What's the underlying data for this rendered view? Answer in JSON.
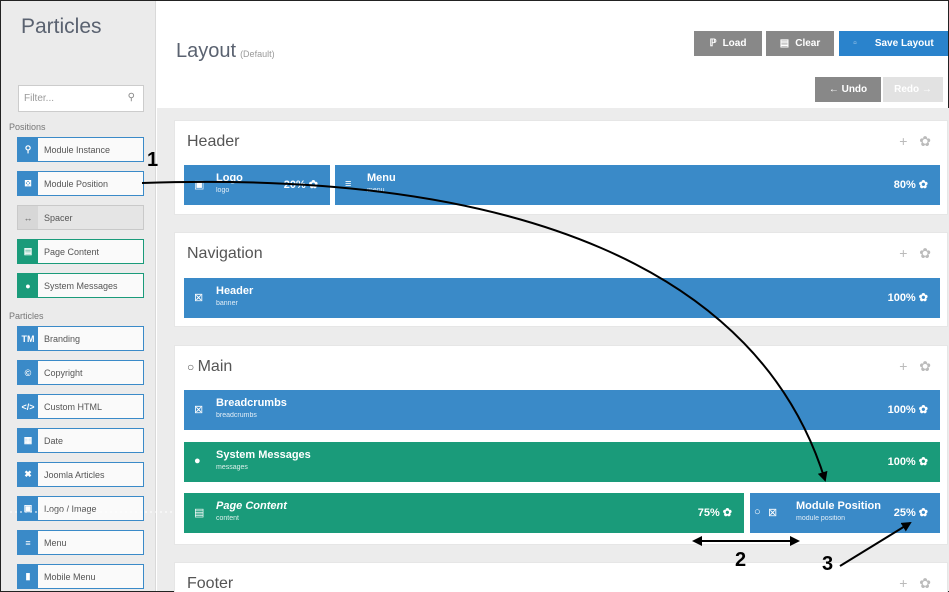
{
  "sidebar": {
    "title": "Particles",
    "filter_placeholder": "Filter...",
    "positions_label": "Positions",
    "particles_label": "Particles",
    "positions": [
      {
        "label": "Module Instance",
        "icon": "puzzle-icon",
        "glyph": "⚲"
      },
      {
        "label": "Module Position",
        "icon": "module-position-icon",
        "glyph": "⊠"
      },
      {
        "label": "Spacer",
        "icon": "spacer-icon",
        "glyph": "↔"
      },
      {
        "label": "Page Content",
        "icon": "file-icon",
        "glyph": "▤"
      },
      {
        "label": "System Messages",
        "icon": "info-icon",
        "glyph": "●"
      }
    ],
    "particles": [
      {
        "label": "Branding",
        "icon": "trademark-icon",
        "glyph": "TM"
      },
      {
        "label": "Copyright",
        "icon": "copyright-icon",
        "glyph": "©"
      },
      {
        "label": "Custom HTML",
        "icon": "code-icon",
        "glyph": "</>"
      },
      {
        "label": "Date",
        "icon": "calendar-icon",
        "glyph": "▦"
      },
      {
        "label": "Joomla Articles",
        "icon": "joomla-icon",
        "glyph": "✖"
      },
      {
        "label": "Logo / Image",
        "icon": "image-icon",
        "glyph": "▣"
      },
      {
        "label": "Menu",
        "icon": "menu-icon",
        "glyph": "≡"
      },
      {
        "label": "Mobile Menu",
        "icon": "mobile-icon",
        "glyph": "▮"
      }
    ]
  },
  "header": {
    "title": "Layout",
    "subtitle": "(Default)",
    "load_label": "Load",
    "clear_label": "Clear",
    "save_label": "Save Layout",
    "undo_label": "← Undo",
    "redo_label": "Redo →"
  },
  "sections": {
    "header": {
      "title": "Header",
      "logo": {
        "title": "Logo",
        "sub": "logo",
        "pct": "20% ✿"
      },
      "menu": {
        "title": "Menu",
        "sub": "menu",
        "pct": "80% ✿"
      }
    },
    "navigation": {
      "title": "Navigation",
      "header_block": {
        "title": "Header",
        "sub": "banner",
        "pct": "100% ✿"
      }
    },
    "main": {
      "title": "Main",
      "breadcrumbs": {
        "title": "Breadcrumbs",
        "sub": "breadcrumbs",
        "pct": "100% ✿"
      },
      "system": {
        "title": "System Messages",
        "sub": "messages",
        "pct": "100% ✿"
      },
      "content": {
        "title": "Page Content",
        "sub": "content",
        "pct": "75% ✿"
      },
      "modpos": {
        "title": "Module Position",
        "sub": "module position",
        "pct": "25% ✿"
      }
    },
    "footer": {
      "title": "Footer"
    }
  },
  "tools_glyph": "+ ✿",
  "annotations": {
    "one": "1",
    "two": "2",
    "three": "3"
  },
  "colors": {
    "blue": "#3a8ac8",
    "green": "#1a9b7a",
    "save": "#2a83cc"
  }
}
